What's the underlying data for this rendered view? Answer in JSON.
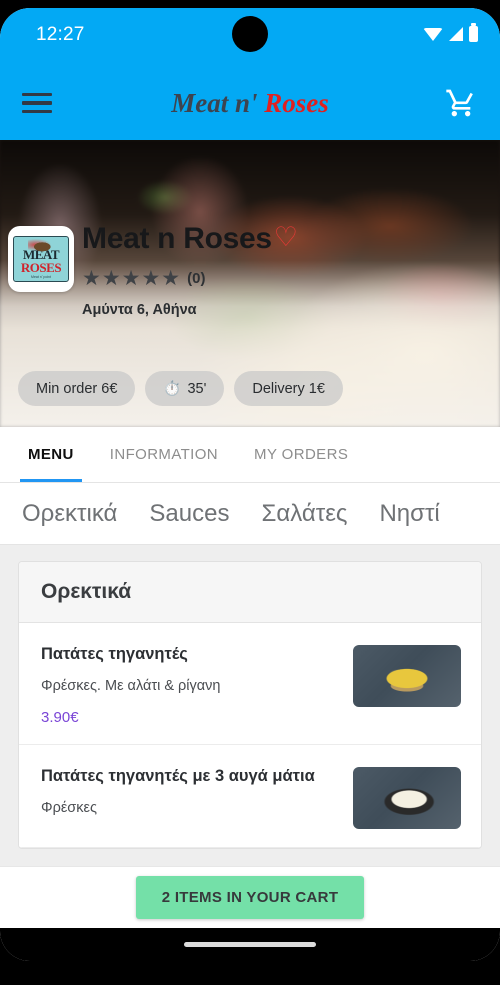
{
  "status_bar": {
    "time": "12:27",
    "icons": [
      "wifi-icon",
      "signal-icon",
      "battery-icon"
    ]
  },
  "app_bar": {
    "menu_icon": "hamburger-menu-icon",
    "brand_part1": "Meat nʹ",
    "brand_part2": "Roses",
    "cart_icon": "shopping-cart-icon",
    "background_color": "#03A9F4"
  },
  "hero": {
    "logo_line1": "MEAT",
    "logo_line2": "ROSES",
    "logo_tagline": "Meat nʹ point",
    "restaurant_name": "Meat n Roses",
    "favorite_icon": "♡",
    "favorite_color": "#e53935",
    "stars": "★★★★★",
    "rating_count": "(0)",
    "address": "Αμύντα 6, Αθήνα",
    "chips": [
      {
        "label": "Min order 6€",
        "icon": ""
      },
      {
        "label": "35'",
        "icon": "⏱️"
      },
      {
        "label": "Delivery 1€",
        "icon": ""
      }
    ]
  },
  "tabs": [
    {
      "label": "MENU",
      "active": true
    },
    {
      "label": "INFORMATION",
      "active": false
    },
    {
      "label": "MY ORDERS",
      "active": false
    }
  ],
  "categories": [
    {
      "label": "Ορεκτικά"
    },
    {
      "label": "Sauces"
    },
    {
      "label": "Σαλάτες"
    },
    {
      "label": "Νηστί"
    }
  ],
  "menu": {
    "section_title": "Ορεκτικά",
    "items": [
      {
        "name": "Πατάτες τηγανητές",
        "description": "Φρέσκες. Με αλάτι & ρίγανη",
        "price": "3.90€",
        "thumb": "fries-photo"
      },
      {
        "name": "Πατάτες τηγανητές με 3 αυγά μάτια",
        "description": "Φρέσκες",
        "price": "",
        "thumb": "fried-eggs-photo"
      }
    ]
  },
  "cart_bar": {
    "button_label": "2 ITEMS IN YOUR CART",
    "button_color": "#74e0a8"
  },
  "nav_bar": {
    "home_indicator": "home-indicator"
  }
}
